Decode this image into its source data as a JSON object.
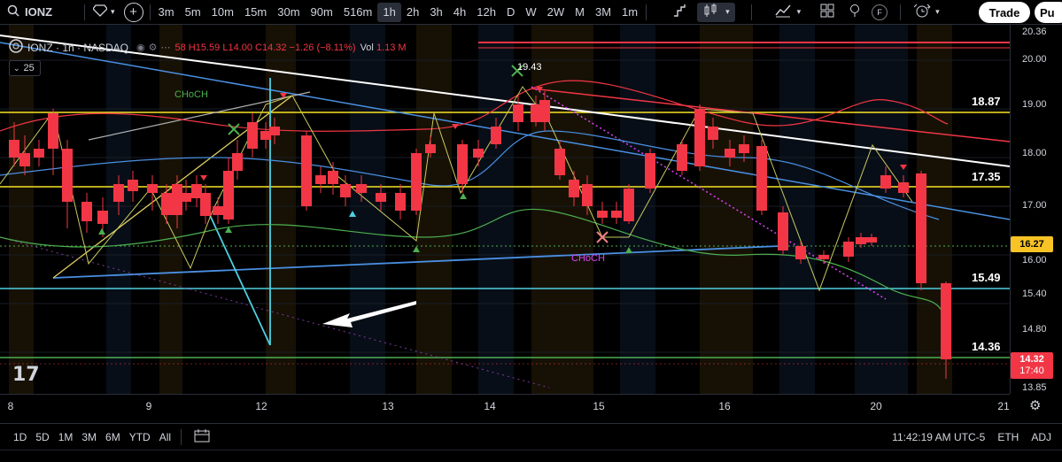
{
  "toolbar": {
    "symbol": "IONZ",
    "intervals": [
      "3m",
      "5m",
      "10m",
      "15m",
      "30m",
      "90m",
      "516m",
      "1h",
      "2h",
      "3h",
      "4h",
      "12h",
      "D",
      "W",
      "2W",
      "M",
      "3M",
      "1m"
    ],
    "active_interval": "1h",
    "trade_label": "Trade",
    "publish_label": "Pu",
    "f_label": "F"
  },
  "legend": {
    "title": "IONZ · 1h · NASDAQ",
    "ohlc": "58 H15.59 L14.00 C14.32 −1.26 (−8.11%)",
    "vol_label": "Vol",
    "vol_value": "1.13 M",
    "indicator_count": "25"
  },
  "annotations": {
    "choch_1": "CHoCH",
    "choch_2": "CHoCH",
    "peak_label": "19.43"
  },
  "price_axis": {
    "ticks": [
      "20.00",
      "19.00",
      "18.00",
      "17.00",
      "16.00",
      "15.40",
      "14.80",
      "13.85"
    ],
    "partial_top": "20.36",
    "current_price": "14.32",
    "countdown": "17:40",
    "marker_price": "16.27",
    "current_color": "#f23645",
    "marker_color": "#f7c325"
  },
  "level_labels": [
    "18.87",
    "17.35",
    "15.49",
    "14.36"
  ],
  "time_axis": {
    "labels": [
      "8",
      "9",
      "12",
      "13",
      "14",
      "15",
      "16",
      "20",
      "21"
    ]
  },
  "bottom_bar": {
    "ranges": [
      "1D",
      "5D",
      "1M",
      "3M",
      "6M",
      "YTD",
      "All"
    ],
    "clock": "11:42:19 AM UTC-5",
    "session": "ETH",
    "adj": "ADJ"
  },
  "colors": {
    "up": "#089981",
    "down": "#f23645",
    "level_yellow": "#f7e325",
    "level_cyan": "#4dd0e1",
    "level_green": "#4caf50"
  }
}
